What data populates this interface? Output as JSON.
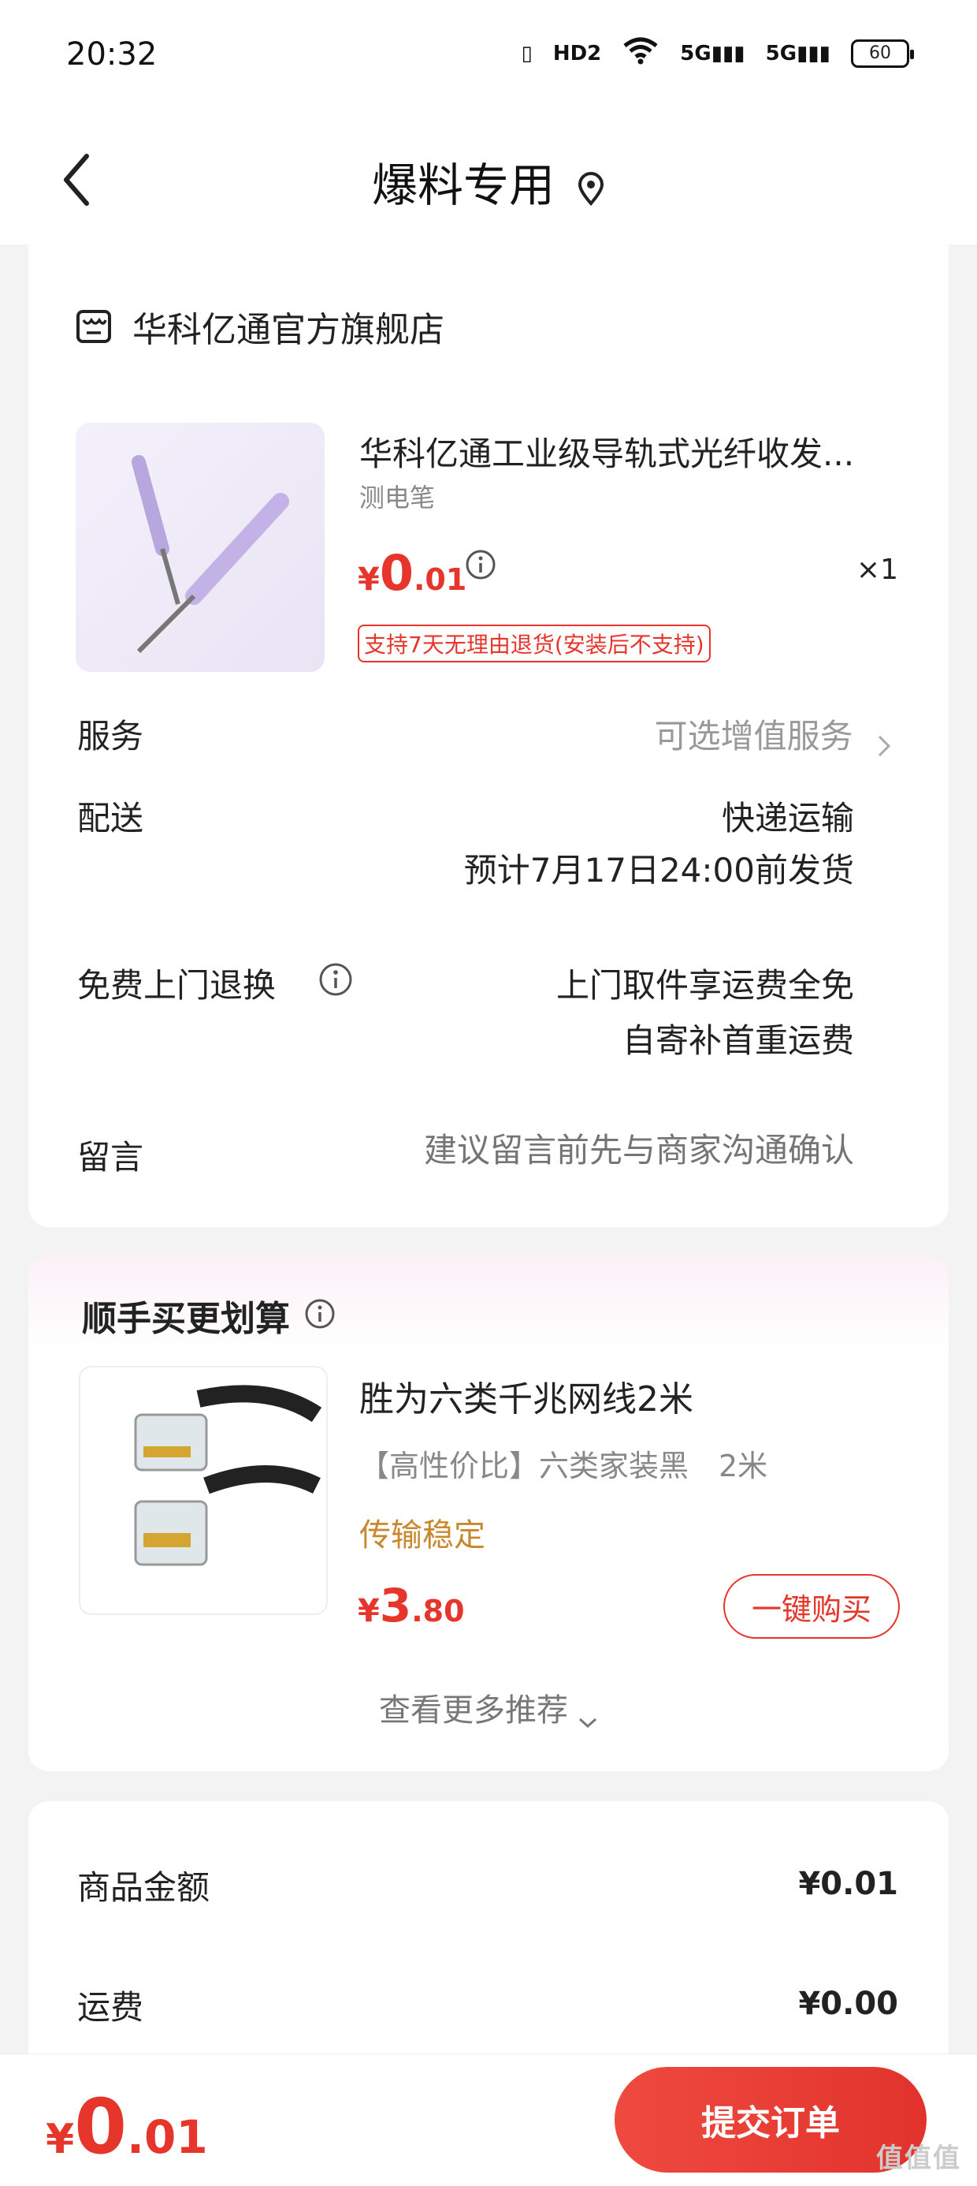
{
  "status_bar": {
    "time": "20:32",
    "hd": "HD2",
    "net1": "5G",
    "net2": "5G",
    "battery": "60"
  },
  "header": {
    "title": "爆料专用"
  },
  "store": {
    "name": "华科亿通官方旗舰店"
  },
  "product": {
    "title": "华科亿通工业级导轨式光纤收发...",
    "sku": "测电笔",
    "price_symbol": "¥",
    "price_int": "0",
    "price_dec": ".01",
    "quantity": "×1",
    "return_policy": "支持7天无理由退货(安装后不支持)"
  },
  "service": {
    "label": "服务",
    "value": "可选增值服务"
  },
  "delivery": {
    "label": "配送",
    "method": "快递运输",
    "eta": "预计7月17日24:00前发货"
  },
  "free_return": {
    "label": "免费上门退换",
    "line1": "上门取件享运费全免",
    "line2": "自寄补首重运费"
  },
  "message": {
    "label": "留言",
    "placeholder": "建议留言前先与商家沟通确认"
  },
  "recommend": {
    "title": "顺手买更划算",
    "item_name": "胜为六类千兆网线2米",
    "item_spec": "【高性价比】六类家装黑　2米",
    "item_tag": "传输稳定",
    "price_symbol": "¥",
    "price_int": "3",
    "price_dec": ".80",
    "buy_label": "一键购买",
    "more_label": "查看更多推荐"
  },
  "summary": {
    "goods_label": "商品金额",
    "goods_value": "¥0.01",
    "shipping_label": "运费",
    "shipping_value": "¥0.00"
  },
  "bottom": {
    "price_symbol": "¥",
    "price_int": "0",
    "price_dec": ".01",
    "submit_label": "提交订单",
    "watermark": "值值值"
  },
  "colors": {
    "accent": "#e6352b",
    "tag_orange": "#c9882e"
  }
}
